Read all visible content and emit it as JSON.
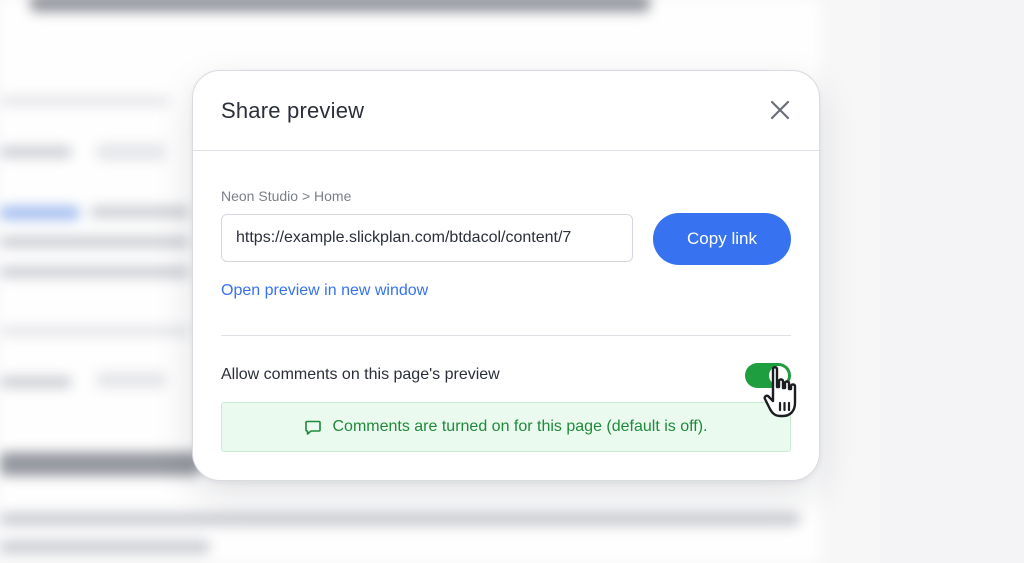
{
  "dialog": {
    "title": "Share preview",
    "close_icon": "close-icon",
    "breadcrumb": "Neon Studio > Home",
    "url": "https://example.slickplan.com/btdacol/content/7",
    "copy_label": "Copy link",
    "open_link_label": "Open preview in new window",
    "comments_label": "Allow comments on this page's preview",
    "comments_enabled": true,
    "notice_icon": "comment-icon",
    "notice_text": "Comments are turned on for this page (default is off)."
  },
  "colors": {
    "accent": "#3772f0",
    "toggle_on": "#1f9e3f",
    "notice_bg": "#eafaef",
    "notice_text": "#1f8a3a"
  }
}
